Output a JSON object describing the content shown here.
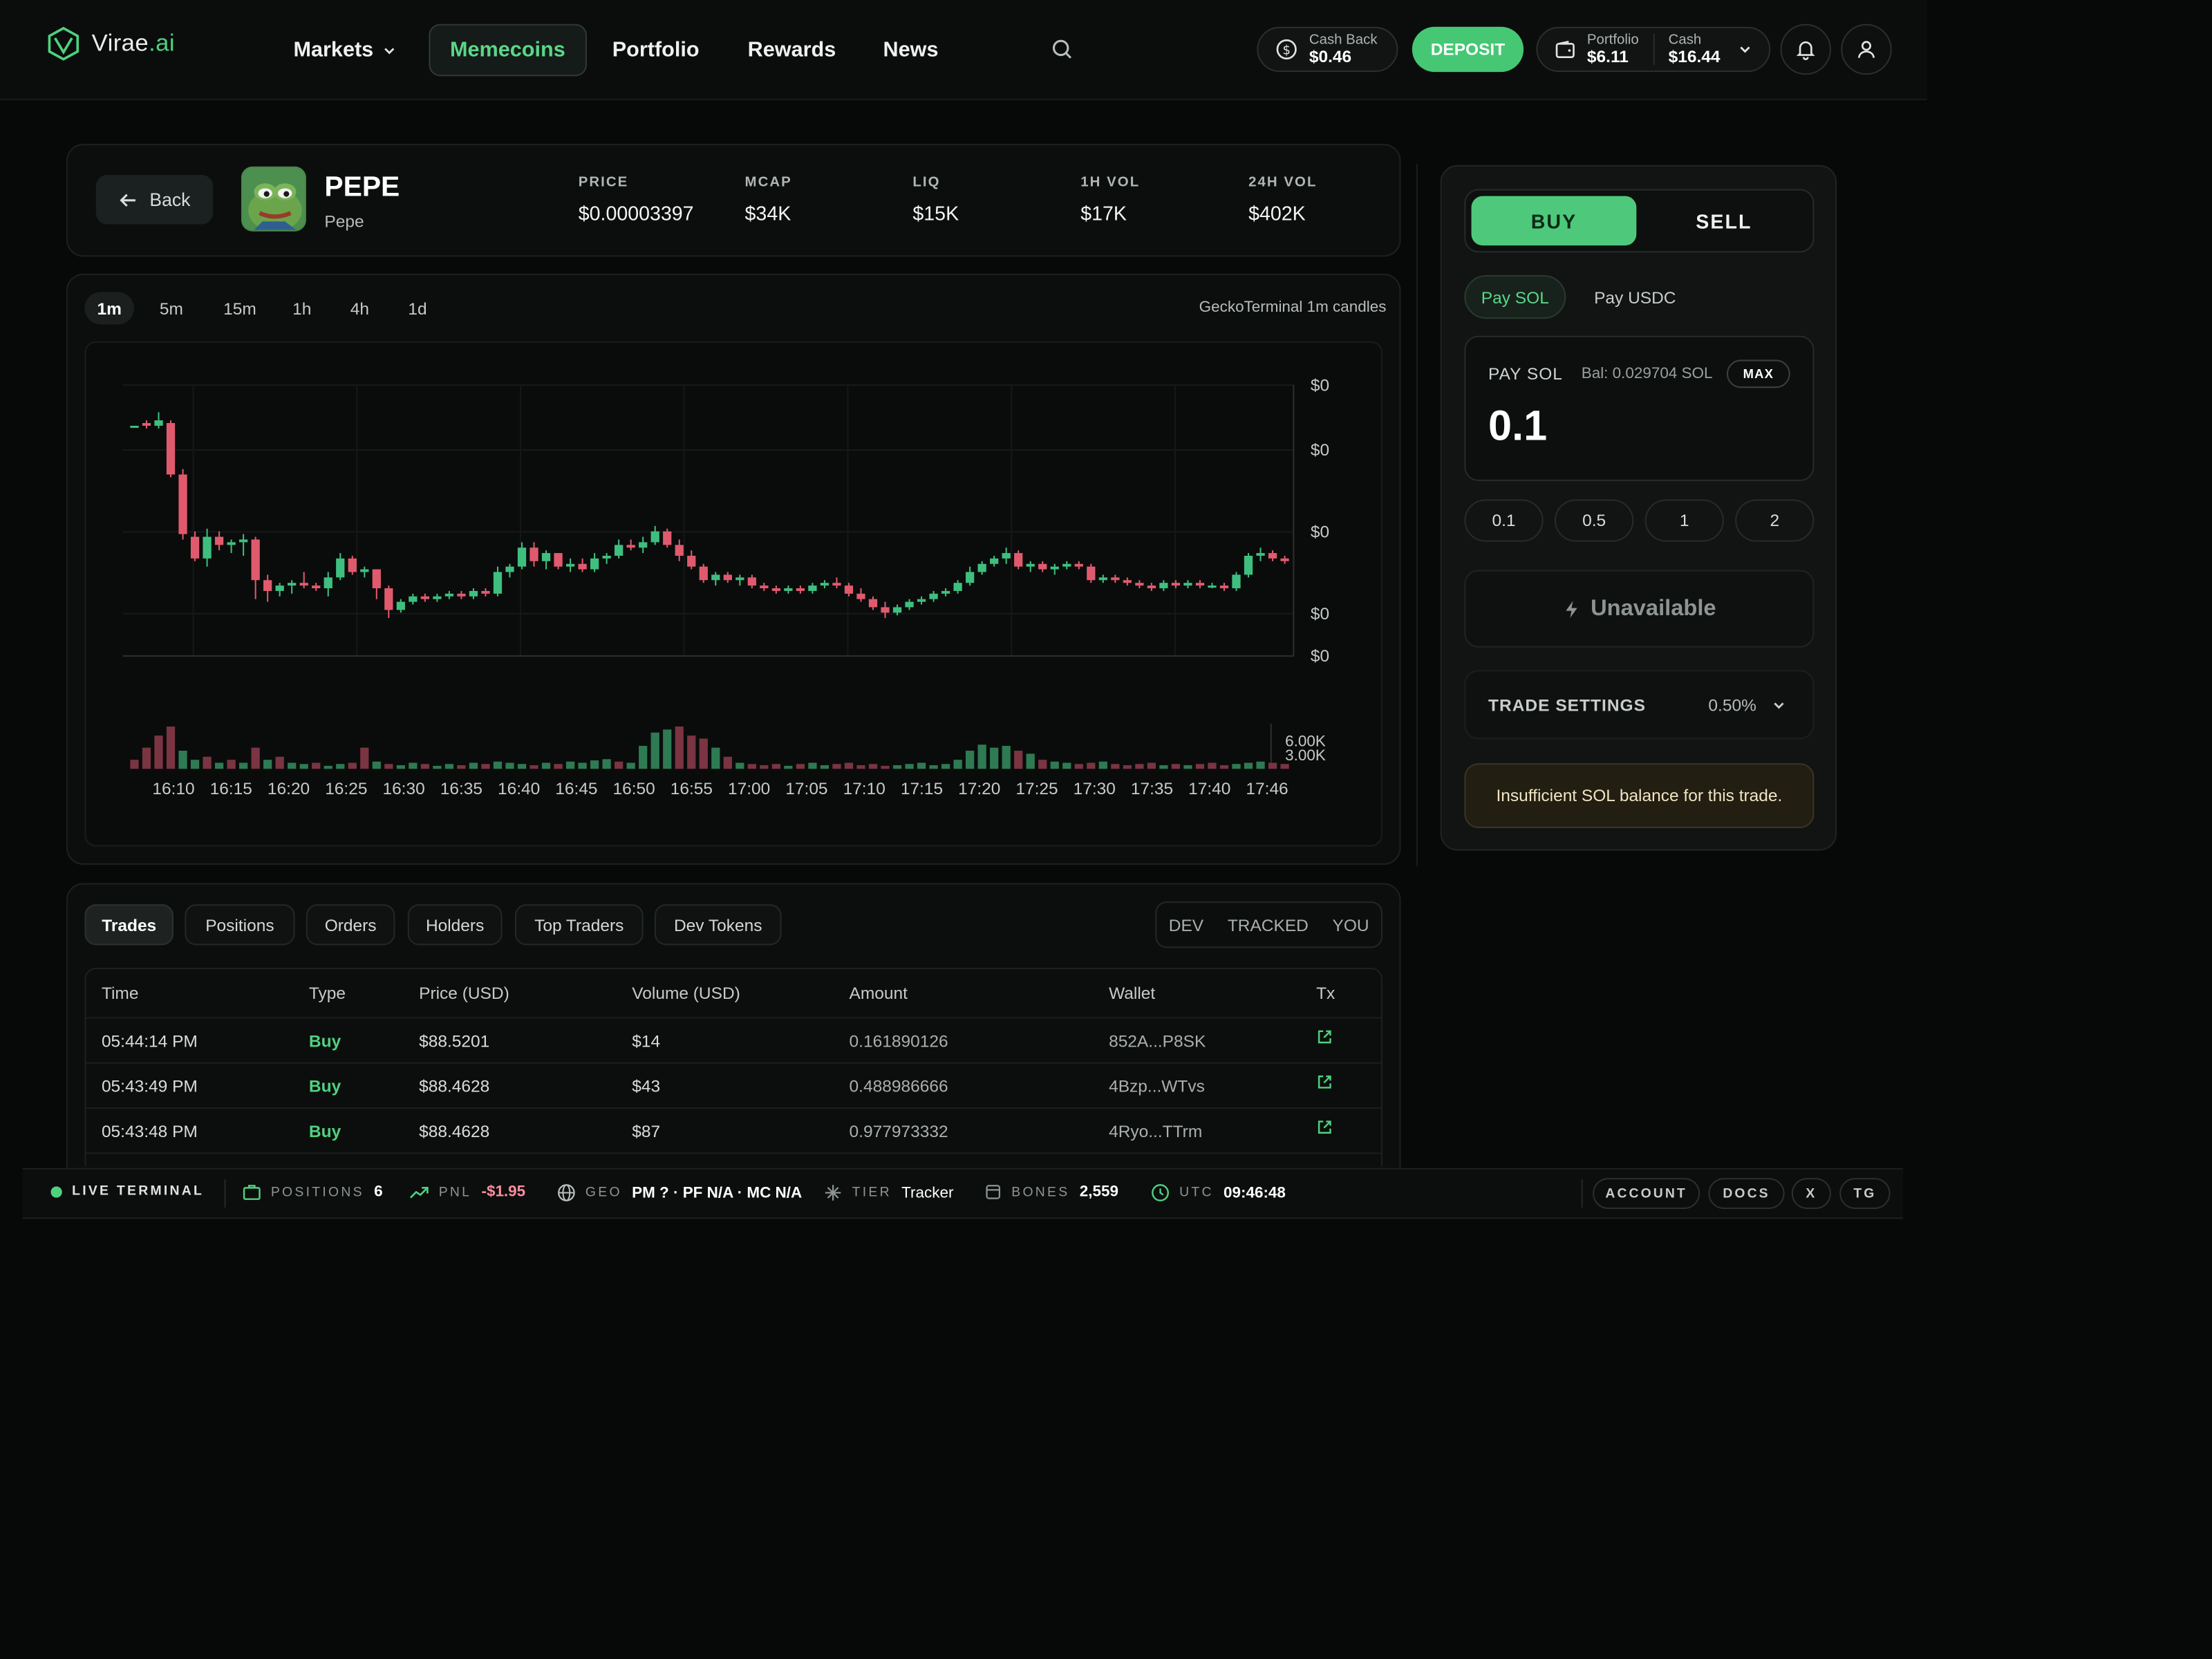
{
  "brand": {
    "name": "Virae",
    "suffix": ".ai"
  },
  "nav": {
    "items": [
      {
        "label": "Markets"
      },
      {
        "label": "Memecoins"
      },
      {
        "label": "Portfolio"
      },
      {
        "label": "Rewards"
      },
      {
        "label": "News"
      }
    ]
  },
  "header": {
    "cashback_label": "Cash Back",
    "cashback_value": "$0.46",
    "deposit_label": "DEPOSIT",
    "portfolio_label": "Portfolio",
    "portfolio_value": "$6.11",
    "cash_label": "Cash",
    "cash_value": "$16.44"
  },
  "token": {
    "back_label": "Back",
    "symbol": "PEPE",
    "name": "Pepe",
    "stats": [
      {
        "label": "PRICE",
        "value": "$0.00003397"
      },
      {
        "label": "MCAP",
        "value": "$34K"
      },
      {
        "label": "LIQ",
        "value": "$15K"
      },
      {
        "label": "1H VOL",
        "value": "$17K"
      },
      {
        "label": "24H VOL",
        "value": "$402K"
      }
    ]
  },
  "chart": {
    "timeframes": [
      "1m",
      "5m",
      "15m",
      "1h",
      "4h",
      "1d"
    ],
    "source_label": "GeckoTerminal 1m candles"
  },
  "chart_data": {
    "type": "candlestick",
    "x_ticks": [
      "16:10",
      "16:15",
      "16:20",
      "16:25",
      "16:30",
      "16:35",
      "16:40",
      "16:45",
      "16:50",
      "16:55",
      "17:00",
      "17:05",
      "17:10",
      "17:15",
      "17:20",
      "17:25",
      "17:30",
      "17:35",
      "17:40",
      "17:46"
    ],
    "price_ticks": [
      "$0",
      "$0",
      "$0",
      "$0",
      "$0"
    ],
    "volume_ticks": [
      "6.00K",
      "3.00K"
    ],
    "ylim": [
      0,
      100
    ],
    "colors": {
      "up": "#3fbf7f",
      "down": "#e05a6e"
    },
    "candles": [
      [
        85,
        85,
        85,
        85
      ],
      [
        86,
        87,
        84,
        85
      ],
      [
        85,
        90,
        84,
        87
      ],
      [
        86,
        87,
        66,
        67
      ],
      [
        67,
        69,
        43,
        45
      ],
      [
        44,
        46,
        35,
        36
      ],
      [
        36,
        47,
        33,
        44
      ],
      [
        44,
        46,
        39,
        41
      ],
      [
        41,
        43,
        38,
        42
      ],
      [
        42,
        45,
        37,
        43
      ],
      [
        43,
        44,
        21,
        28
      ],
      [
        28,
        30,
        20,
        24
      ],
      [
        24,
        27,
        22,
        26
      ],
      [
        26,
        28,
        23,
        27
      ],
      [
        27,
        31,
        25,
        26
      ],
      [
        26,
        27,
        24,
        25
      ],
      [
        25,
        31,
        22,
        29
      ],
      [
        29,
        38,
        28,
        36
      ],
      [
        36,
        37,
        30,
        31
      ],
      [
        31,
        33,
        29,
        32
      ],
      [
        32,
        32,
        21,
        25
      ],
      [
        25,
        26,
        14,
        17
      ],
      [
        17,
        21,
        16,
        20
      ],
      [
        20,
        23,
        19,
        22
      ],
      [
        22,
        23,
        20,
        21
      ],
      [
        21,
        23,
        20,
        22
      ],
      [
        22,
        24,
        21,
        23
      ],
      [
        23,
        24,
        21,
        22
      ],
      [
        22,
        25,
        21,
        24
      ],
      [
        24,
        25,
        22,
        23
      ],
      [
        23,
        33,
        22,
        31
      ],
      [
        31,
        34,
        29,
        33
      ],
      [
        33,
        42,
        32,
        40
      ],
      [
        40,
        42,
        33,
        35
      ],
      [
        35,
        39,
        32,
        38
      ],
      [
        38,
        38,
        32,
        33
      ],
      [
        33,
        36,
        31,
        34
      ],
      [
        34,
        36,
        31,
        32
      ],
      [
        32,
        38,
        31,
        36
      ],
      [
        36,
        38,
        34,
        37
      ],
      [
        37,
        43,
        36,
        41
      ],
      [
        41,
        43,
        39,
        40
      ],
      [
        40,
        44,
        38,
        42
      ],
      [
        42,
        48,
        41,
        46
      ],
      [
        46,
        47,
        40,
        41
      ],
      [
        41,
        43,
        35,
        37
      ],
      [
        37,
        39,
        32,
        33
      ],
      [
        33,
        34,
        27,
        28
      ],
      [
        28,
        31,
        26,
        30
      ],
      [
        30,
        31,
        27,
        28
      ],
      [
        28,
        30,
        26,
        29
      ],
      [
        29,
        30,
        25,
        26
      ],
      [
        26,
        27,
        24,
        25
      ],
      [
        25,
        26,
        23,
        24
      ],
      [
        24,
        26,
        23,
        25
      ],
      [
        25,
        26,
        23,
        24
      ],
      [
        24,
        27,
        23,
        26
      ],
      [
        26,
        28,
        25,
        27
      ],
      [
        27,
        29,
        25,
        26
      ],
      [
        26,
        27,
        22,
        23
      ],
      [
        23,
        25,
        20,
        21
      ],
      [
        21,
        22,
        17,
        18
      ],
      [
        18,
        20,
        14,
        16
      ],
      [
        16,
        19,
        15,
        18
      ],
      [
        18,
        21,
        17,
        20
      ],
      [
        20,
        22,
        19,
        21
      ],
      [
        21,
        24,
        20,
        23
      ],
      [
        23,
        25,
        22,
        24
      ],
      [
        24,
        28,
        23,
        27
      ],
      [
        27,
        33,
        26,
        31
      ],
      [
        31,
        35,
        30,
        34
      ],
      [
        34,
        37,
        33,
        36
      ],
      [
        36,
        40,
        34,
        38
      ],
      [
        38,
        39,
        32,
        33
      ],
      [
        33,
        35,
        31,
        34
      ],
      [
        34,
        35,
        31,
        32
      ],
      [
        32,
        34,
        30,
        33
      ],
      [
        33,
        35,
        32,
        34
      ],
      [
        34,
        35,
        32,
        33
      ],
      [
        33,
        34,
        27,
        28
      ],
      [
        28,
        30,
        27,
        29
      ],
      [
        29,
        30,
        27,
        28
      ],
      [
        28,
        29,
        26,
        27
      ],
      [
        27,
        28,
        25,
        26
      ],
      [
        26,
        27,
        24,
        25
      ],
      [
        25,
        28,
        24,
        27
      ],
      [
        27,
        28,
        25,
        26
      ],
      [
        26,
        28,
        25,
        27
      ],
      [
        27,
        28,
        25,
        26
      ],
      [
        26,
        27,
        25,
        26
      ],
      [
        26,
        27,
        24,
        25
      ],
      [
        25,
        31,
        24,
        30
      ],
      [
        30,
        38,
        29,
        37
      ],
      [
        37,
        40,
        35,
        38
      ],
      [
        38,
        39,
        35,
        36
      ],
      [
        36,
        37,
        34,
        35
      ]
    ],
    "volumes": [
      15,
      35,
      55,
      70,
      30,
      15,
      20,
      10,
      15,
      10,
      35,
      15,
      20,
      10,
      8,
      10,
      5,
      8,
      10,
      35,
      12,
      8,
      6,
      10,
      8,
      5,
      8,
      6,
      10,
      8,
      12,
      10,
      8,
      6,
      10,
      8,
      12,
      10,
      14,
      16,
      12,
      10,
      38,
      60,
      65,
      70,
      55,
      50,
      35,
      20,
      10,
      8,
      6,
      8,
      5,
      8,
      10,
      6,
      8,
      10,
      6,
      8,
      5,
      6,
      8,
      10,
      6,
      8,
      15,
      30,
      40,
      35,
      38,
      30,
      25,
      15,
      12,
      10,
      8,
      10,
      12,
      8,
      6,
      8,
      10,
      6,
      8,
      6,
      8,
      10,
      6,
      8,
      10,
      12,
      10,
      8
    ],
    "volume_colors": [
      "r",
      "r",
      "r",
      "r",
      "g",
      "g",
      "r",
      "g",
      "r",
      "g",
      "r",
      "g",
      "r",
      "g",
      "g",
      "r",
      "g",
      "g",
      "r",
      "r",
      "g",
      "r",
      "g",
      "g",
      "r",
      "g",
      "g",
      "r",
      "g",
      "r",
      "g",
      "g",
      "g",
      "r",
      "g",
      "r",
      "g",
      "g",
      "g",
      "g",
      "r",
      "g",
      "g",
      "g",
      "g",
      "r",
      "r",
      "r",
      "g",
      "r",
      "g",
      "r",
      "r",
      "r",
      "g",
      "r",
      "g",
      "g",
      "r",
      "r",
      "r",
      "r",
      "r",
      "g",
      "g",
      "g",
      "g",
      "g",
      "g",
      "g",
      "g",
      "g",
      "g",
      "r",
      "g",
      "r",
      "g",
      "g",
      "r",
      "r",
      "g",
      "r",
      "r",
      "r",
      "r",
      "g",
      "r",
      "g",
      "r",
      "r",
      "r",
      "g",
      "g",
      "g",
      "r",
      "r"
    ]
  },
  "activity": {
    "tabs": [
      "Trades",
      "Positions",
      "Orders",
      "Holders",
      "Top Traders",
      "Dev Tokens"
    ],
    "filters": [
      "DEV",
      "TRACKED",
      "YOU"
    ],
    "columns": [
      "Time",
      "Type",
      "Price (USD)",
      "Volume (USD)",
      "Amount",
      "Wallet",
      "Tx"
    ],
    "rows": [
      {
        "time": "05:44:14 PM",
        "type": "Buy",
        "price": "$88.5201",
        "volume": "$14",
        "amount": "0.161890126",
        "wallet": "852A...P8SK"
      },
      {
        "time": "05:43:49 PM",
        "type": "Buy",
        "price": "$88.4628",
        "volume": "$43",
        "amount": "0.488986666",
        "wallet": "4Bzp...WTvs"
      },
      {
        "time": "05:43:48 PM",
        "type": "Buy",
        "price": "$88.4628",
        "volume": "$87",
        "amount": "0.977973332",
        "wallet": "4Ryo...TTrm"
      }
    ]
  },
  "trade": {
    "buy_label": "BUY",
    "sell_label": "SELL",
    "pay_sol": "Pay SOL",
    "pay_usdc": "Pay USDC",
    "pay_label": "PAY SOL",
    "balance": "Bal: 0.029704 SOL",
    "max_label": "MAX",
    "amount": "0.1",
    "presets": [
      "0.1",
      "0.5",
      "1",
      "2"
    ],
    "unavailable_label": "Unavailable",
    "settings_label": "TRADE SETTINGS",
    "slippage": "0.50%",
    "warning": "Insufficient SOL balance for this trade."
  },
  "statusbar": {
    "live_label": "LIVE TERMINAL",
    "positions_label": "POSITIONS",
    "positions_value": "6",
    "pnl_label": "PNL",
    "pnl_value": "-$1.95",
    "geo_label": "GEO",
    "geo_value": "PM ? · PF N/A · MC N/A",
    "tier_label": "TIER",
    "tier_value": "Tracker",
    "bones_label": "BONES",
    "bones_value": "2,559",
    "utc_label": "UTC",
    "utc_value": "09:46:48",
    "buttons": [
      "ACCOUNT",
      "DOCS",
      "X",
      "TG"
    ]
  },
  "colors": {
    "accent": "#46c774",
    "danger": "#e05a6e",
    "background": "#070808"
  }
}
